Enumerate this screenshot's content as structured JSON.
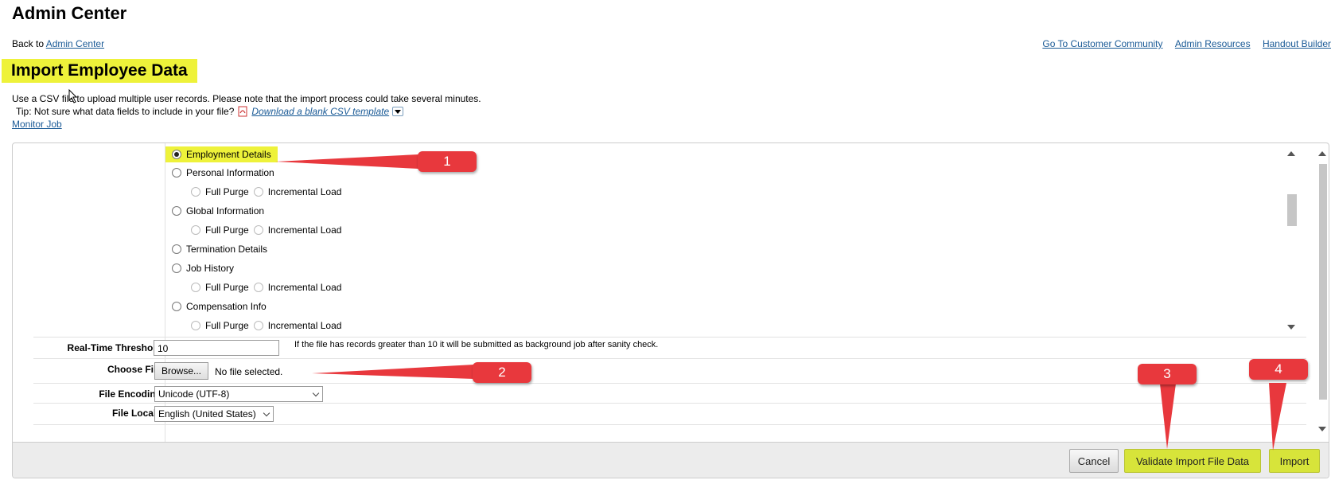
{
  "app_title": "Admin Center",
  "back": {
    "prefix": "Back to",
    "link": "Admin Center"
  },
  "top_links": [
    "Go To Customer Community",
    "Admin Resources",
    "Handout Builder"
  ],
  "page_title": "Import Employee Data",
  "intro": "Use a CSV file to upload multiple user records. Please note that the import process could take several minutes.",
  "tip": {
    "text": "Tip: Not sure what data fields to include in your file?",
    "link": "Download a blank CSV template"
  },
  "monitor_job": "Monitor Job",
  "import_types": [
    {
      "label": "Employment Details",
      "selected": true
    },
    {
      "label": "Personal Information",
      "selected": false
    },
    {
      "label": "Global Information",
      "selected": false
    },
    {
      "label": "Termination Details",
      "selected": false
    },
    {
      "label": "Job History",
      "selected": false
    },
    {
      "label": "Compensation Info",
      "selected": false
    }
  ],
  "sub_options": {
    "full_purge": "Full Purge",
    "incremental_load": "Incremental Load"
  },
  "form": {
    "threshold_label": "Real-Time Threshold:",
    "threshold_value": "10",
    "threshold_note": "If the file has records greater than 10 it will be submitted as background job after sanity check.",
    "choose_file_label": "Choose File:",
    "browse_label": "Browse...",
    "no_file": "No file selected.",
    "encoding_label": "File Encoding:",
    "encoding_value": "Unicode (UTF-8)",
    "locale_label": "File Locale:",
    "locale_value": "English (United States)"
  },
  "buttons": {
    "cancel": "Cancel",
    "validate": "Validate Import File Data",
    "import": "Import"
  },
  "callouts": [
    "1",
    "2",
    "3",
    "4"
  ],
  "colors": {
    "highlight": "#eef23a",
    "callout": "#e8383d",
    "link": "#1a5a96"
  }
}
